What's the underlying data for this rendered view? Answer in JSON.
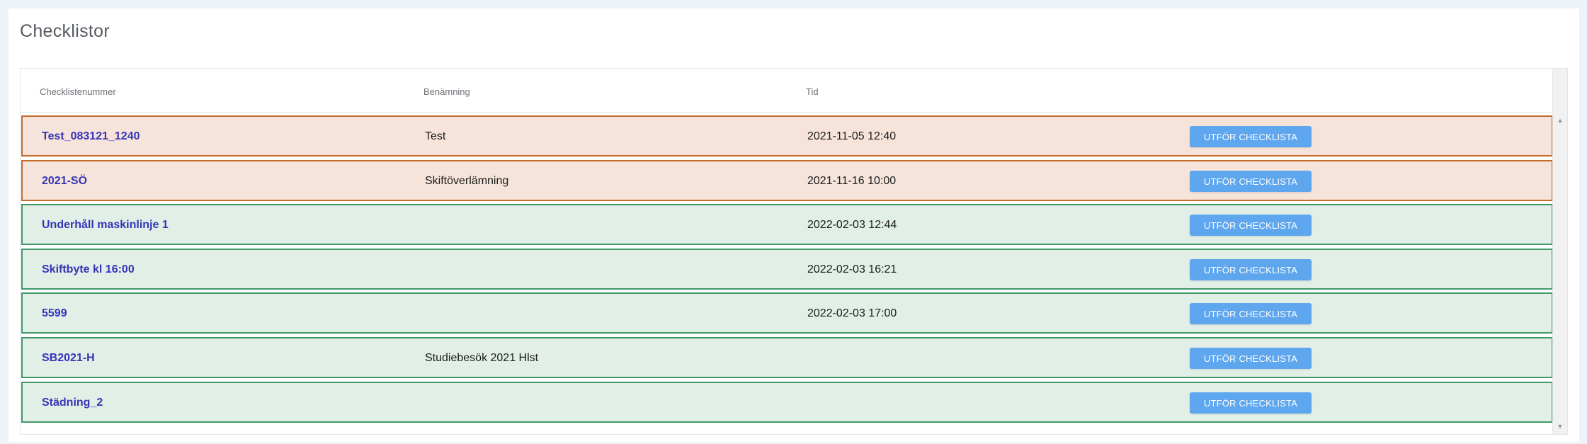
{
  "page": {
    "title": "Checklistor"
  },
  "table": {
    "headers": {
      "number": "Checklistenummer",
      "name": "Benämning",
      "time": "Tid"
    },
    "rows": [
      {
        "number": "Test_083121_1240",
        "name": "Test",
        "time": "2021-11-05 12:40",
        "action": "UTFÖR CHECKLISTA",
        "status": "orange"
      },
      {
        "number": "2021-SÖ",
        "name": "Skiftöverlämning",
        "time": "2021-11-16 10:00",
        "action": "UTFÖR CHECKLISTA",
        "status": "orange"
      },
      {
        "number": "Underhåll maskinlinje 1",
        "name": "",
        "time": "2022-02-03 12:44",
        "action": "UTFÖR CHECKLISTA",
        "status": "green"
      },
      {
        "number": "Skiftbyte kl 16:00",
        "name": "",
        "time": "2022-02-03 16:21",
        "action": "UTFÖR CHECKLISTA",
        "status": "green"
      },
      {
        "number": "5599",
        "name": "",
        "time": "2022-02-03 17:00",
        "action": "UTFÖR CHECKLISTA",
        "status": "green"
      },
      {
        "number": "SB2021-H",
        "name": "Studiebesök 2021 Hlst",
        "time": "",
        "action": "UTFÖR CHECKLISTA",
        "status": "green"
      },
      {
        "number": "Städning_2",
        "name": "",
        "time": "",
        "action": "UTFÖR CHECKLISTA",
        "status": "green"
      }
    ]
  },
  "colors": {
    "orange_bg": "#f6e4da",
    "orange_border": "#c66a2c",
    "green_bg": "#e1efe7",
    "green_border": "#3f9a68",
    "link": "#3535b8",
    "button": "#5ea6ee"
  },
  "icons": {
    "scroll_up": "triangle-up-icon",
    "scroll_down": "triangle-down-icon"
  }
}
